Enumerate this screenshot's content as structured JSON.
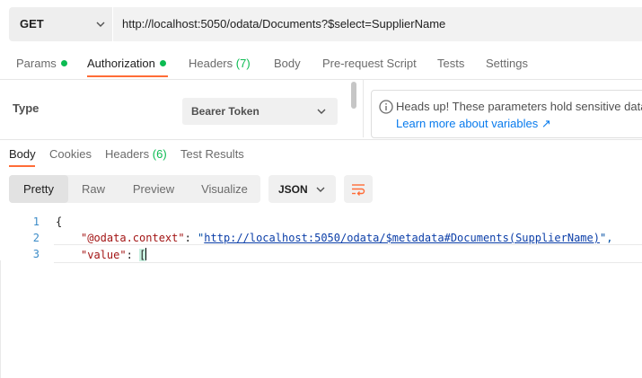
{
  "request": {
    "method": "GET",
    "url": "http://localhost:5050/odata/Documents?$select=SupplierName"
  },
  "request_tabs": [
    {
      "label": "Params",
      "dot": true
    },
    {
      "label": "Authorization",
      "dot": true,
      "active": true
    },
    {
      "label": "Headers",
      "count": "(7)"
    },
    {
      "label": "Body"
    },
    {
      "label": "Pre-request Script"
    },
    {
      "label": "Tests"
    },
    {
      "label": "Settings"
    }
  ],
  "auth": {
    "type_label": "Type",
    "type_value": "Bearer Token",
    "notice_line1": "Heads up! These parameters hold sensitive data",
    "notice_link": "Learn more about variables ↗"
  },
  "response_tabs": [
    {
      "label": "Body",
      "active": true
    },
    {
      "label": "Cookies"
    },
    {
      "label": "Headers",
      "count": "(6)"
    },
    {
      "label": "Test Results"
    }
  ],
  "view_modes": [
    {
      "label": "Pretty",
      "active": true
    },
    {
      "label": "Raw"
    },
    {
      "label": "Preview"
    },
    {
      "label": "Visualize"
    }
  ],
  "format": "JSON",
  "code": {
    "line_numbers": [
      "1",
      "2",
      "3"
    ],
    "line1": "{",
    "context_key": "\"@odata.context\"",
    "context_colon": ": ",
    "context_quote_open": "\"",
    "context_value": "http://localhost:5050/odata/$metadata#Documents(SupplierName)",
    "context_quote_close": "\",",
    "value_key": "\"value\"",
    "value_colon": ": ",
    "value_bracket": "["
  },
  "colors": {
    "accent": "#ff6c37",
    "status_dot": "#0cbb52",
    "link": "#097bed"
  }
}
